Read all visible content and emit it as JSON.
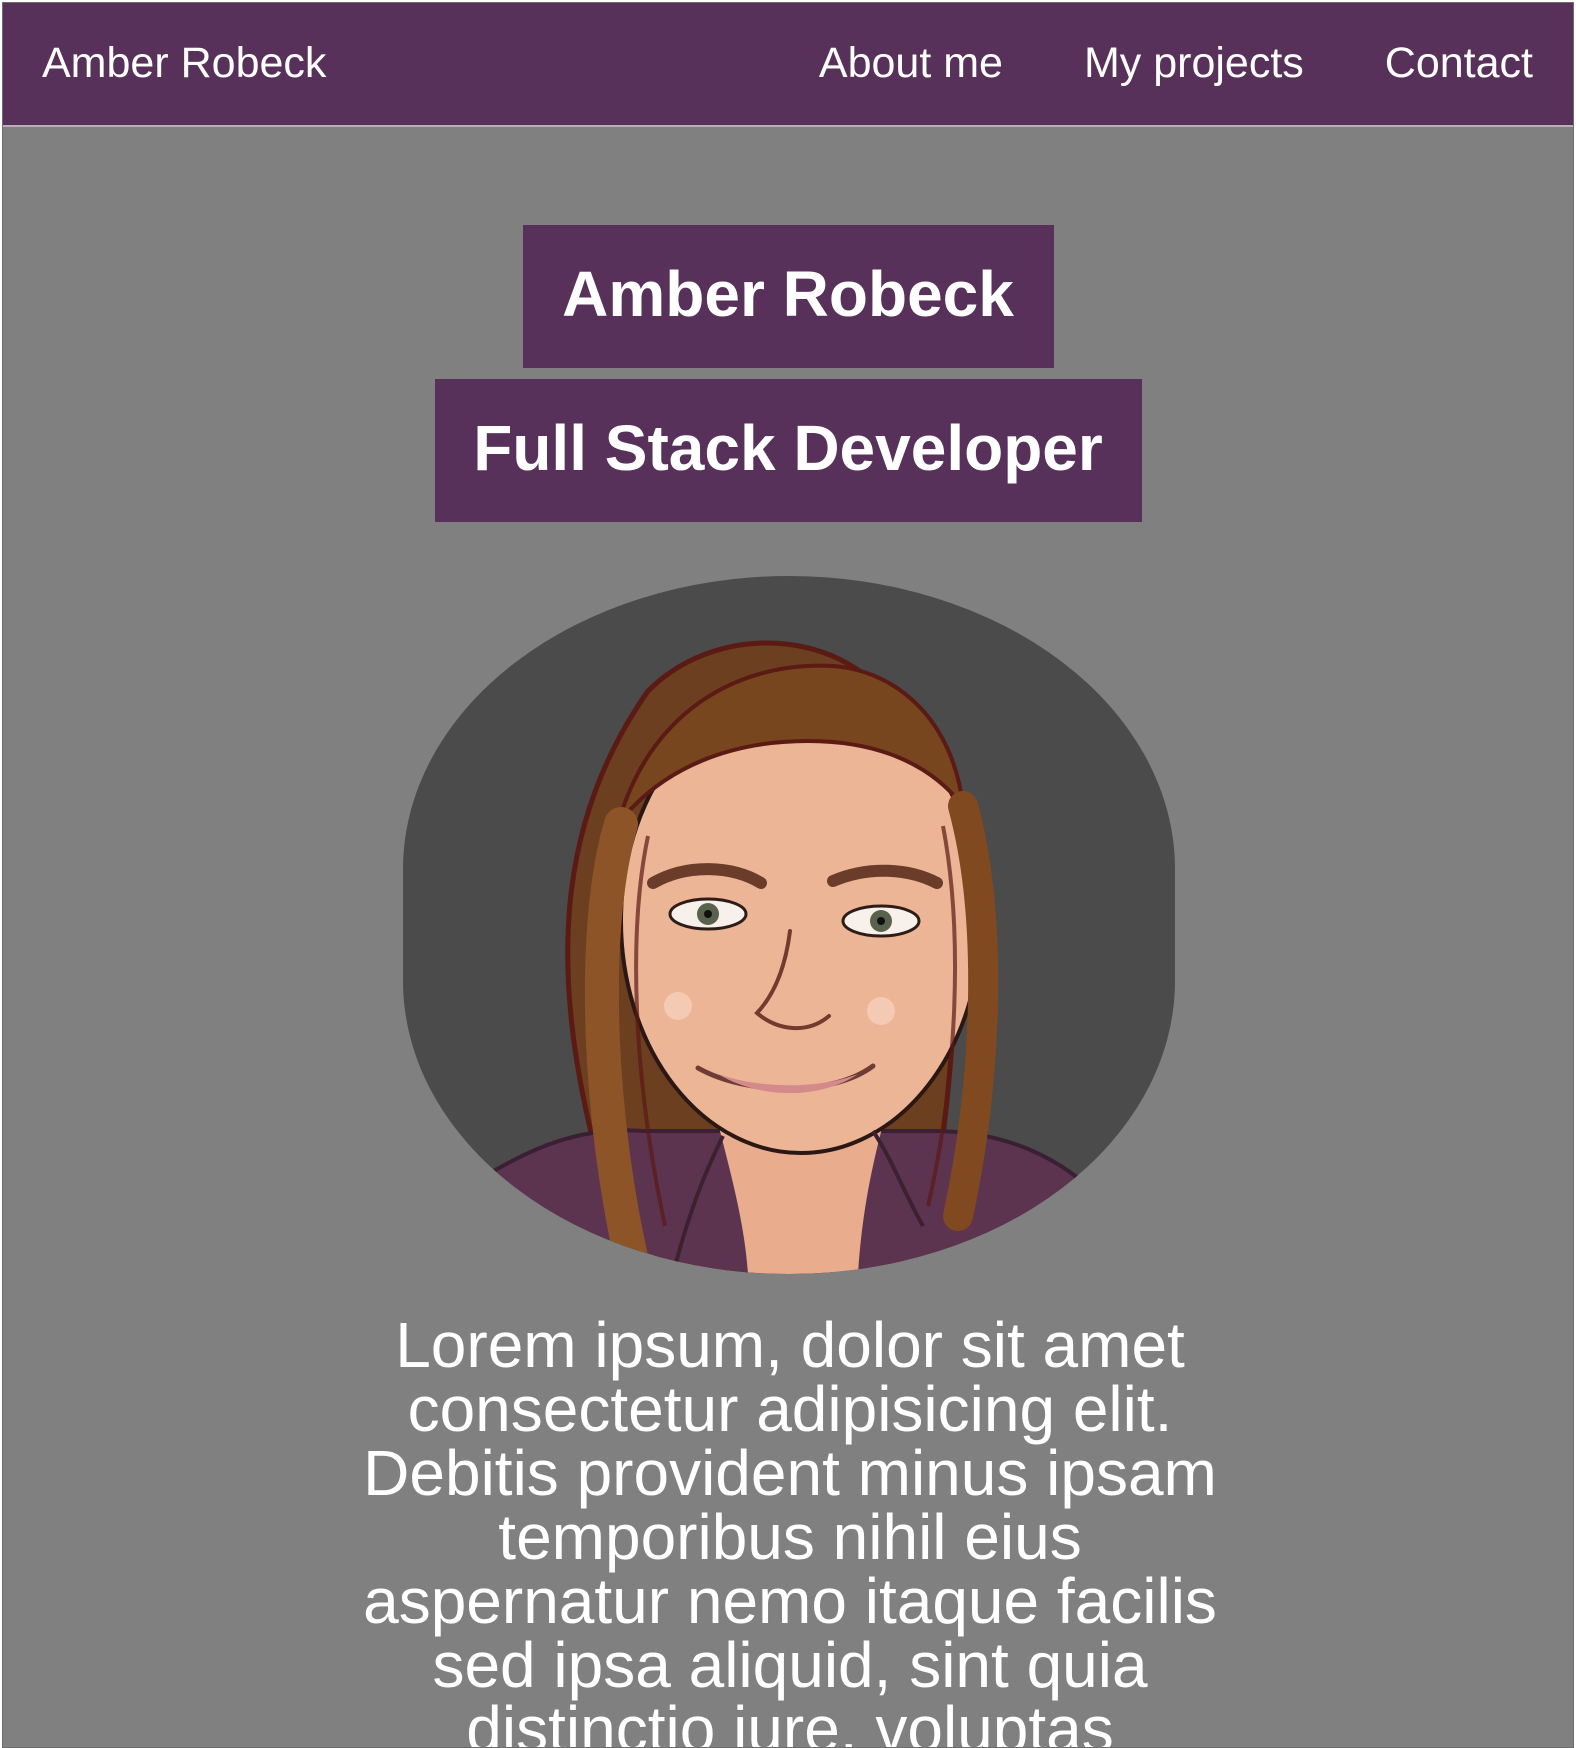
{
  "nav": {
    "brand": "Amber Robeck",
    "links": [
      {
        "label": "About me"
      },
      {
        "label": "My projects"
      },
      {
        "label": "Contact"
      }
    ]
  },
  "hero": {
    "name": "Amber Robeck",
    "role": "Full Stack Developer"
  },
  "portrait": {
    "alt": "avatar-illustration"
  },
  "bio": {
    "text": "Lorem ipsum, dolor sit amet consectetur adipisicing elit. Debitis provident minus ipsam temporibus nihil eius aspernatur nemo itaque facilis sed ipsa aliquid, sint quia distinctio iure, voluptas"
  },
  "colors": {
    "nav_background": "#573159",
    "page_background": "#808080",
    "portrait_background": "#4b4b4b",
    "text": "#ffffff"
  }
}
